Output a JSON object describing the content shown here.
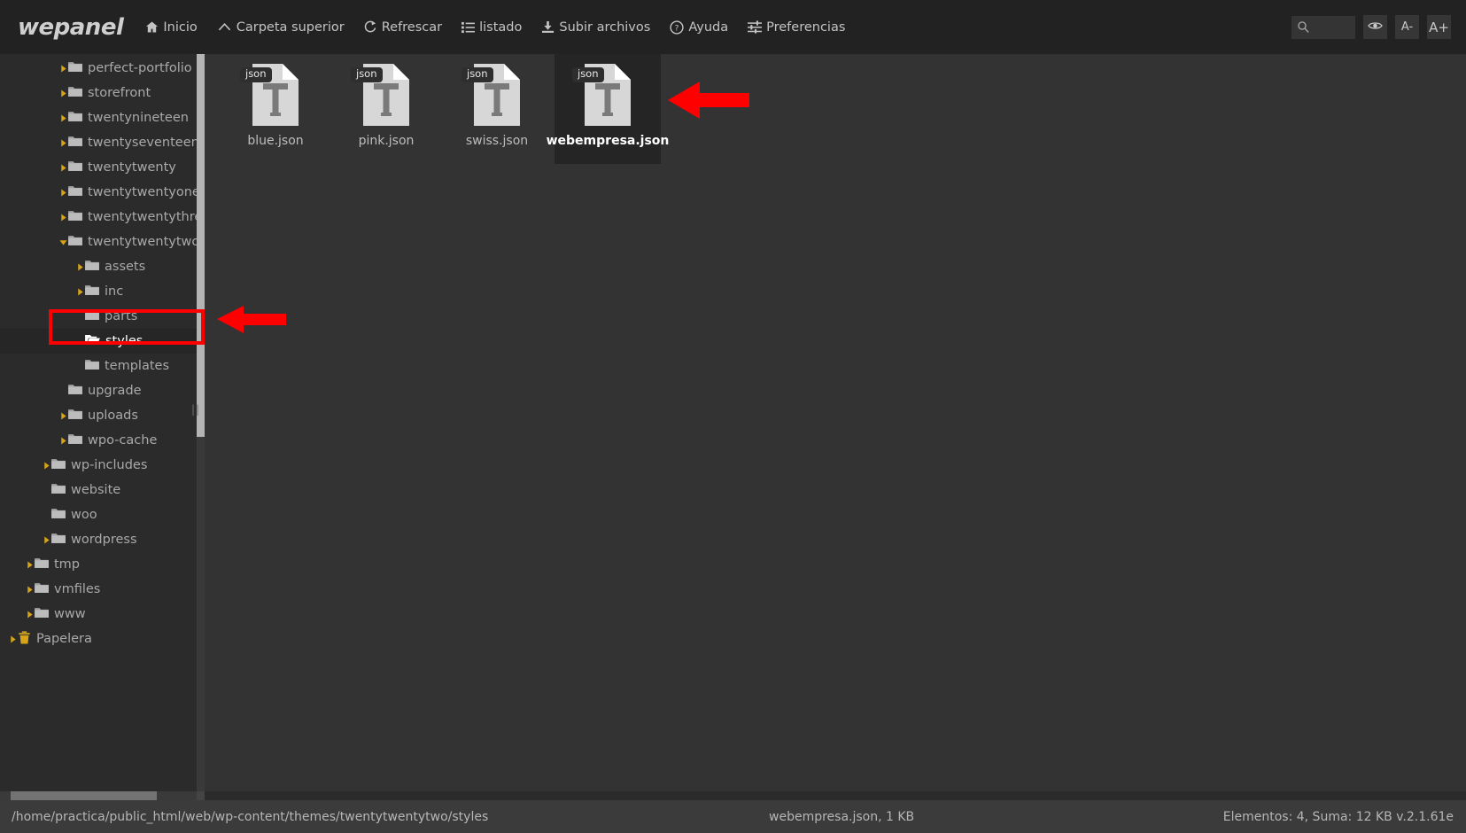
{
  "header": {
    "brand": "wepanel",
    "toolbar": [
      {
        "label": "Inicio",
        "icon": "home-icon"
      },
      {
        "label": "Carpeta superior",
        "icon": "chevron-up-icon"
      },
      {
        "label": "Refrescar",
        "icon": "refresh-icon"
      },
      {
        "label": "listado",
        "icon": "list-icon"
      },
      {
        "label": "Subir archivos",
        "icon": "upload-icon"
      },
      {
        "label": "Ayuda",
        "icon": "help-circle-icon"
      },
      {
        "label": "Preferencias",
        "icon": "sliders-icon"
      }
    ],
    "search": {
      "placeholder": "",
      "value": "",
      "icon": "search-icon"
    },
    "buttons": [
      {
        "label": "",
        "icon": "eye-icon",
        "name": "toggle-hidden-button"
      },
      {
        "label": "A-",
        "icon": "font-decrease-icon",
        "name": "font-decrease-button"
      },
      {
        "label": "A+",
        "icon": "font-increase-icon",
        "name": "font-increase-button"
      }
    ]
  },
  "sidebar": {
    "nodes": [
      {
        "label": "perfect-portfolio",
        "depth": 2,
        "caret": "closed",
        "icon": "folder-icon",
        "selected": false
      },
      {
        "label": "storefront",
        "depth": 2,
        "caret": "closed",
        "icon": "folder-icon",
        "selected": false
      },
      {
        "label": "twentynineteen",
        "depth": 2,
        "caret": "closed",
        "icon": "folder-icon",
        "selected": false
      },
      {
        "label": "twentyseventeen",
        "depth": 2,
        "caret": "closed",
        "icon": "folder-icon",
        "selected": false
      },
      {
        "label": "twentytwenty",
        "depth": 2,
        "caret": "closed",
        "icon": "folder-icon",
        "selected": false
      },
      {
        "label": "twentytwentyone",
        "depth": 2,
        "caret": "closed",
        "icon": "folder-icon",
        "selected": false
      },
      {
        "label": "twentytwentythree",
        "depth": 2,
        "caret": "closed",
        "icon": "folder-icon",
        "selected": false
      },
      {
        "label": "twentytwentytwo",
        "depth": 2,
        "caret": "open",
        "icon": "folder-icon",
        "selected": false
      },
      {
        "label": "assets",
        "depth": 3,
        "caret": "closed",
        "icon": "folder-icon",
        "selected": false
      },
      {
        "label": "inc",
        "depth": 3,
        "caret": "closed",
        "icon": "folder-icon",
        "selected": false
      },
      {
        "label": "parts",
        "depth": 3,
        "caret": "none",
        "icon": "folder-icon",
        "selected": false
      },
      {
        "label": "styles",
        "depth": 3,
        "caret": "none",
        "icon": "folder-open-icon",
        "selected": true
      },
      {
        "label": "templates",
        "depth": 3,
        "caret": "none",
        "icon": "folder-icon",
        "selected": false
      },
      {
        "label": "upgrade",
        "depth": 2,
        "caret": "none",
        "icon": "folder-icon",
        "selected": false
      },
      {
        "label": "uploads",
        "depth": 2,
        "caret": "closed",
        "icon": "folder-icon",
        "selected": false
      },
      {
        "label": "wpo-cache",
        "depth": 2,
        "caret": "closed",
        "icon": "folder-icon",
        "selected": false
      },
      {
        "label": "wp-includes",
        "depth": 1,
        "caret": "closed",
        "icon": "folder-icon",
        "selected": false
      },
      {
        "label": "website",
        "depth": 1,
        "caret": "none",
        "icon": "folder-icon",
        "selected": false
      },
      {
        "label": "woo",
        "depth": 1,
        "caret": "none",
        "icon": "folder-icon",
        "selected": false
      },
      {
        "label": "wordpress",
        "depth": 1,
        "caret": "closed",
        "icon": "folder-icon",
        "selected": false
      },
      {
        "label": "tmp",
        "depth": 0,
        "caret": "closed",
        "icon": "folder-icon",
        "selected": false
      },
      {
        "label": "vmfiles",
        "depth": 0,
        "caret": "closed",
        "icon": "folder-icon",
        "selected": false
      },
      {
        "label": "www",
        "depth": 0,
        "caret": "closed",
        "icon": "folder-icon",
        "selected": false
      },
      {
        "label": "Papelera",
        "depth": -1,
        "caret": "closed",
        "icon": "trash-icon",
        "selected": false
      }
    ]
  },
  "main": {
    "files": [
      {
        "name": "blue.json",
        "badge": "json",
        "selected": false
      },
      {
        "name": "pink.json",
        "badge": "json",
        "selected": false
      },
      {
        "name": "swiss.json",
        "badge": "json",
        "selected": false
      },
      {
        "name": "webempresa.json",
        "badge": "json",
        "selected": true
      }
    ]
  },
  "status": {
    "path": "/home/practica/public_html/web/wp-content/themes/twentytwentytwo/styles",
    "selected_file": "webempresa.json, 1 KB",
    "summary": "Elementos: 4, Suma: 12 KB v.2.1.61e"
  },
  "annotations": {
    "highlight_color": "#fe0000",
    "arrows": [
      {
        "name": "arrow-pointing-to-selected-file",
        "direction": "left"
      },
      {
        "name": "arrow-pointing-to-styles-folder",
        "direction": "left"
      }
    ]
  }
}
